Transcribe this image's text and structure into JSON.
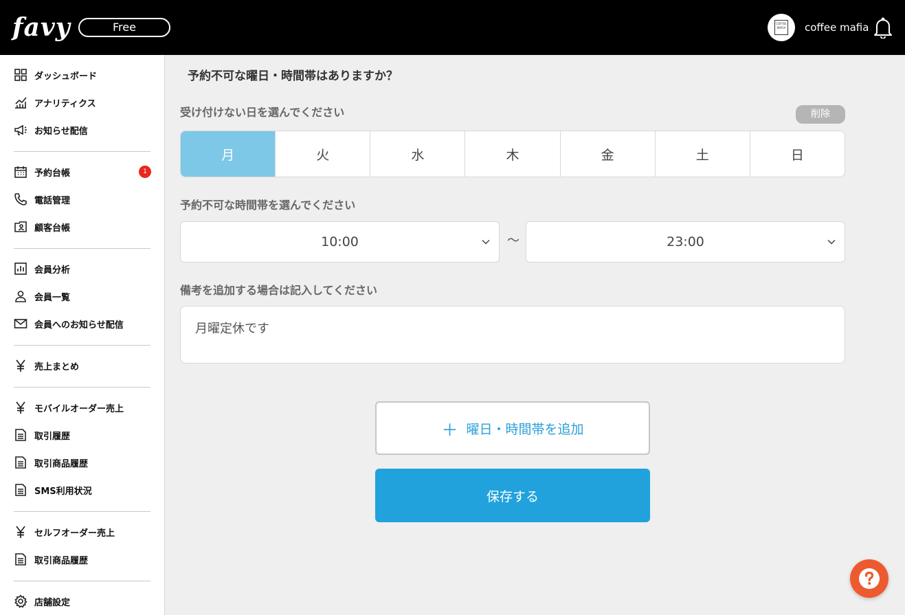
{
  "header": {
    "logo": "favy",
    "plan": "Free",
    "avatar_text": "COFFEE MAFIA",
    "shop_name": "coffee mafia"
  },
  "sidebar": {
    "items": [
      {
        "label": "ダッシュボード",
        "icon": "dashboard-grid-icon"
      },
      {
        "label": "アナリティクス",
        "icon": "analytics-chart-icon"
      },
      {
        "label": "お知らせ配信",
        "icon": "megaphone-icon"
      },
      {
        "label": "予約台帳",
        "icon": "calendar-icon",
        "badge": "1"
      },
      {
        "label": "電話管理",
        "icon": "phone-icon"
      },
      {
        "label": "顧客台帳",
        "icon": "contact-card-icon"
      },
      {
        "label": "会員分析",
        "icon": "bar-chart-icon"
      },
      {
        "label": "会員一覧",
        "icon": "person-icon"
      },
      {
        "label": "会員へのお知らせ配信",
        "icon": "mail-icon"
      },
      {
        "label": "売上まとめ",
        "icon": "yen-icon"
      },
      {
        "label": "モバイルオーダー売上",
        "icon": "yen-icon"
      },
      {
        "label": "取引履歴",
        "icon": "document-icon"
      },
      {
        "label": "取引商品履歴",
        "icon": "document-icon"
      },
      {
        "label": "SMS利用状況",
        "icon": "document-icon"
      },
      {
        "label": "セルフオーダー売上",
        "icon": "yen-icon"
      },
      {
        "label": "取引商品履歴",
        "icon": "document-icon"
      },
      {
        "label": "店舗設定",
        "icon": "gear-icon"
      }
    ]
  },
  "main": {
    "section_title": "予約不可な曜日・時間帯はありますか？",
    "days_label": "受け付けない日を選んでください",
    "delete_label": "削除",
    "days": [
      "月",
      "火",
      "水",
      "木",
      "金",
      "土",
      "日"
    ],
    "selected_day": "月",
    "time_label": "予約不可な時間帯を選んでください",
    "time_from": "10:00",
    "time_separator": "〜",
    "time_to": "23:00",
    "note_label": "備考を追加する場合は記入してください",
    "note_value": "月曜定休です",
    "add_button": "曜日・時間帯を追加",
    "save_button": "保存する"
  },
  "colors": {
    "header_bg": "#000000",
    "selected_day": "#7cc8e6",
    "primary": "#21a2dc",
    "help": "#ee5a2f",
    "badge": "#e8271e"
  }
}
